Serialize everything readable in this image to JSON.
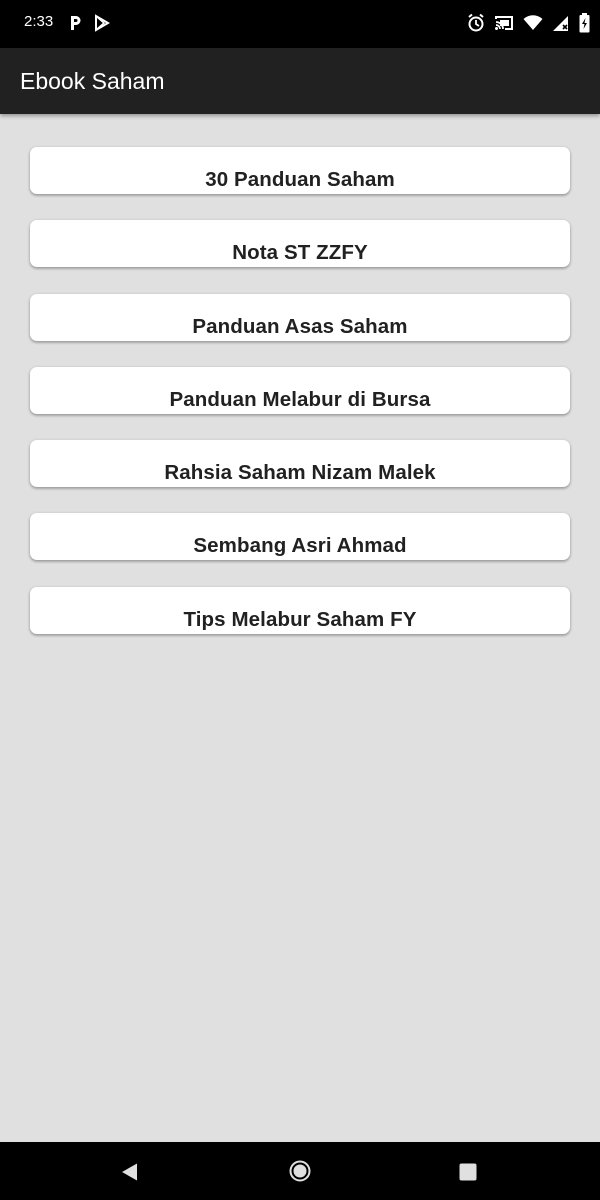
{
  "status_bar": {
    "time": "2:33",
    "left_icons": [
      "parking-icon",
      "play-store-icon"
    ],
    "right_icons": [
      "alarm-icon",
      "cast-icon",
      "wifi-icon",
      "signal-icon",
      "battery-icon"
    ]
  },
  "app_bar": {
    "title": "Ebook Saham",
    "background_color": "#212121"
  },
  "list": {
    "items": [
      {
        "label": "30 Panduan Saham"
      },
      {
        "label": "Nota ST ZZFY"
      },
      {
        "label": "Panduan Asas Saham"
      },
      {
        "label": "Panduan Melabur di Bursa"
      },
      {
        "label": "Rahsia Saham Nizam Malek"
      },
      {
        "label": "Sembang Asri Ahmad"
      },
      {
        "label": "Tips Melabur Saham FY"
      }
    ]
  },
  "nav_bar": {
    "buttons": [
      "back-icon",
      "home-icon",
      "recents-icon"
    ]
  },
  "colors": {
    "background": "#e0e0e0",
    "button": "#ffffff",
    "button_text": "#212121",
    "status_bar": "#000000"
  }
}
